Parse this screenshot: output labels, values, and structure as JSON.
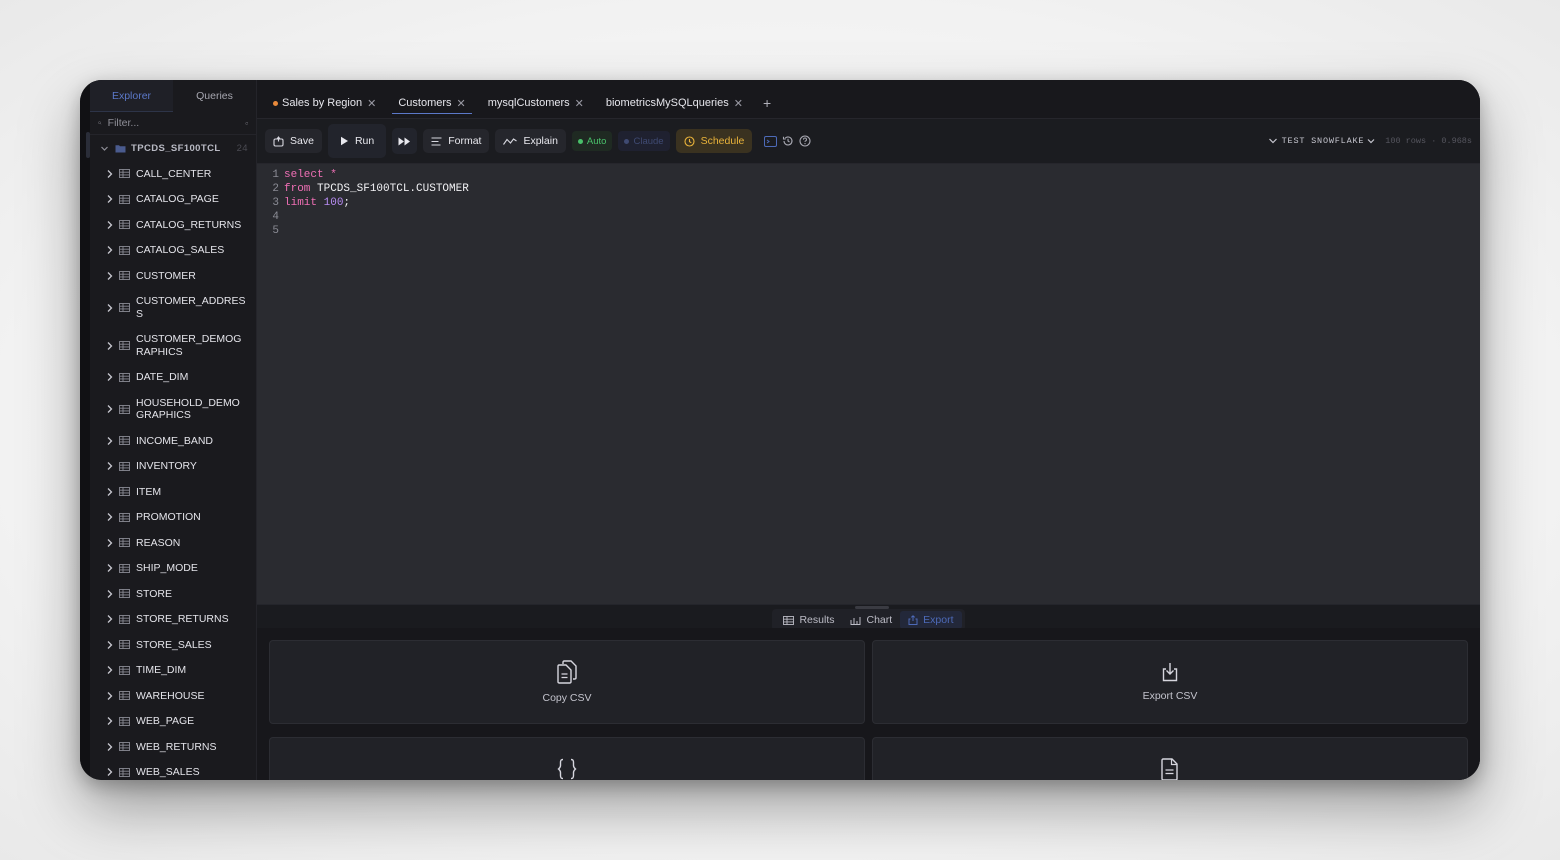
{
  "sidebar": {
    "tabs": [
      "Explorer",
      "Queries"
    ],
    "filter_placeholder": "Filter...",
    "database": {
      "name": "TPCDS_SF100TCL",
      "count": "24"
    },
    "tables": [
      "CALL_CENTER",
      "CATALOG_PAGE",
      "CATALOG_RETURNS",
      "CATALOG_SALES",
      "CUSTOMER",
      "CUSTOMER_ADDRESS",
      "CUSTOMER_DEMOGRAPHICS",
      "DATE_DIM",
      "HOUSEHOLD_DEMOGRAPHICS",
      "INCOME_BAND",
      "INVENTORY",
      "ITEM",
      "PROMOTION",
      "REASON",
      "SHIP_MODE",
      "STORE",
      "STORE_RETURNS",
      "STORE_SALES",
      "TIME_DIM",
      "WAREHOUSE",
      "WEB_PAGE",
      "WEB_RETURNS",
      "WEB_SALES"
    ]
  },
  "tabs": {
    "items": [
      "Sales by Region",
      "Customers",
      "mysqlCustomers",
      "biometricsMySQLqueries"
    ],
    "active": "Customers",
    "add_label": "+"
  },
  "toolbar": {
    "save": "Save",
    "run": "Run",
    "format": "Format",
    "explain": "Explain",
    "auto": "Auto",
    "claude": "Claude",
    "schedule": "Schedule",
    "connection": "TEST SNOWFLAKE",
    "stats": "100 rows · 0.968s"
  },
  "editor": {
    "line_numbers": [
      "1",
      "2",
      "3",
      "4",
      "5"
    ],
    "l1_kw": "select",
    "l1_rest": " *",
    "l2_kw": "from",
    "l2_rest": " TPCDS_SF100TCL.CUSTOMER",
    "l3_kw": "limit",
    "l3_num": " 100",
    "l3_end": ";"
  },
  "results": {
    "tabs": [
      "Results",
      "Chart",
      "Export"
    ],
    "active": "Export"
  },
  "export": {
    "copy_csv": "Copy CSV",
    "export_csv": "Export CSV"
  },
  "colors": {
    "accent": "#5b78c8",
    "keyword": "#ef6fb5",
    "number": "#b78cf2",
    "auto_green": "#49c06a",
    "schedule_amber": "#e8b23a"
  }
}
